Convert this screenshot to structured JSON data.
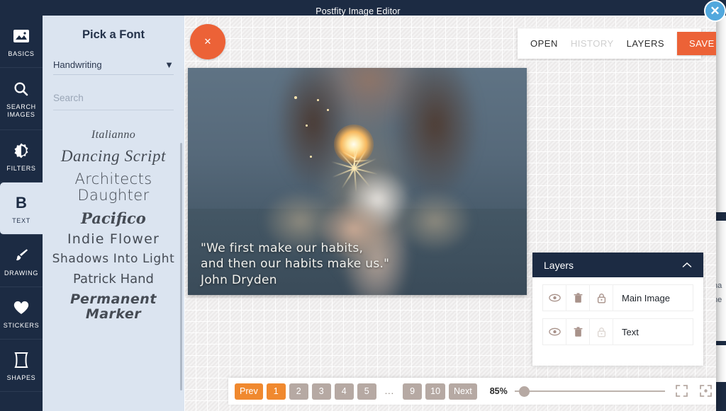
{
  "window": {
    "title": "Postfity Image Editor",
    "close_label": "✕"
  },
  "rail": {
    "items": [
      {
        "label": "BASICS",
        "icon": "image-icon",
        "active": false
      },
      {
        "label": "SEARCH IMAGES",
        "icon": "search-icon",
        "active": false
      },
      {
        "label": "FILTERS",
        "icon": "contrast-icon",
        "active": false
      },
      {
        "label": "TEXT",
        "icon": "bold-b-icon",
        "active": true
      },
      {
        "label": "DRAWING",
        "icon": "brush-icon",
        "active": false
      },
      {
        "label": "STICKERS",
        "icon": "heart-icon",
        "active": false
      },
      {
        "label": "SHAPES",
        "icon": "shape-icon",
        "active": false
      }
    ]
  },
  "font_panel": {
    "title": "Pick a Font",
    "category_selected": "Handwriting",
    "category_caret": "▼",
    "search_placeholder": "Search",
    "search_value": "",
    "fonts": [
      {
        "name": "Italianno",
        "class": "f-italianno"
      },
      {
        "name": "Dancing Script",
        "class": "f-dancing"
      },
      {
        "name": "Architects Daughter",
        "class": "f-architects"
      },
      {
        "name": "Pacifico",
        "class": "f-pacifico"
      },
      {
        "name": "Indie Flower",
        "class": "f-indie"
      },
      {
        "name": "Shadows Into Light",
        "class": "f-shadows"
      },
      {
        "name": "Patrick Hand",
        "class": "f-patrick"
      },
      {
        "name": "Permanent Marker",
        "class": "f-permanent"
      }
    ]
  },
  "canvas": {
    "cancel_label": "✕",
    "image_description": "Woman holding a lit sparkler at dusk",
    "overlay_text": "\"We first make our habits,\nand then our habits make us.\"\nJohn Dryden"
  },
  "toolbar": {
    "open_label": "OPEN",
    "history_label": "HISTORY",
    "layers_label": "LAYERS",
    "save_label": "SAVE",
    "save_color": "#ec6237"
  },
  "layers_panel": {
    "title": "Layers",
    "collapse_caret": "˄",
    "rows": [
      {
        "name": "Main Image",
        "visible": true,
        "locked": false,
        "lock_enabled": true
      },
      {
        "name": "Text",
        "visible": true,
        "locked": false,
        "lock_enabled": false
      }
    ]
  },
  "bottom_bar": {
    "pagination": [
      {
        "label": "Prev",
        "kind": "nav-prev"
      },
      {
        "label": "1",
        "kind": "active"
      },
      {
        "label": "2",
        "kind": "page"
      },
      {
        "label": "3",
        "kind": "page"
      },
      {
        "label": "4",
        "kind": "page"
      },
      {
        "label": "5",
        "kind": "page"
      },
      {
        "label": "...",
        "kind": "dots"
      },
      {
        "label": "9",
        "kind": "page"
      },
      {
        "label": "10",
        "kind": "page"
      },
      {
        "label": "Next",
        "kind": "page"
      }
    ],
    "zoom_value": "85%",
    "zoom_percent": 85,
    "fit_icon": "fit-screen-icon",
    "center_icon": "center-focus-icon"
  },
  "background_page": {
    "ghost_line_1": "na",
    "ghost_line_2": "ne"
  },
  "colors": {
    "accent_orange": "#ec6237",
    "dark_navy": "#1c2b43",
    "panel_blue": "#dbe4f0",
    "close_blue": "#52a8dd"
  }
}
